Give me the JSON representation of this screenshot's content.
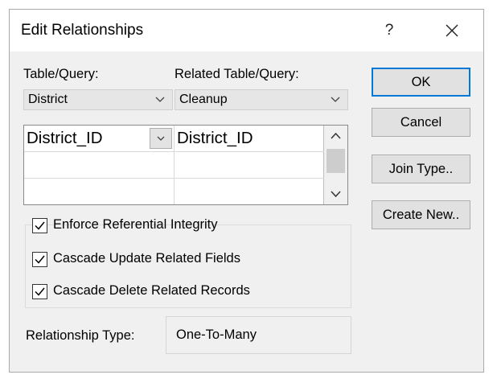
{
  "dialog": {
    "title": "Edit Relationships",
    "help_glyph": "?",
    "close_icon": "close-icon"
  },
  "table_query": {
    "label": "Table/Query:",
    "value": "District"
  },
  "related_table_query": {
    "label": "Related Table/Query:",
    "value": "Cleanup"
  },
  "field_grid": {
    "rows": [
      {
        "left": "District_ID",
        "right": "District_ID"
      },
      {
        "left": "",
        "right": ""
      },
      {
        "left": "",
        "right": ""
      }
    ]
  },
  "options": {
    "enforce_integrity": {
      "label": "Enforce Referential Integrity",
      "checked": true
    },
    "cascade_update": {
      "label": "Cascade Update Related Fields",
      "checked": true
    },
    "cascade_delete": {
      "label": "Cascade Delete Related Records",
      "checked": true
    }
  },
  "relationship_type": {
    "label": "Relationship Type:",
    "value": "One-To-Many"
  },
  "buttons": {
    "ok": "OK",
    "cancel": "Cancel",
    "join_type": "Join Type..",
    "create_new": "Create New.."
  },
  "colors": {
    "dialog_bg": "#f0f0f0",
    "accent": "#0078d7"
  }
}
